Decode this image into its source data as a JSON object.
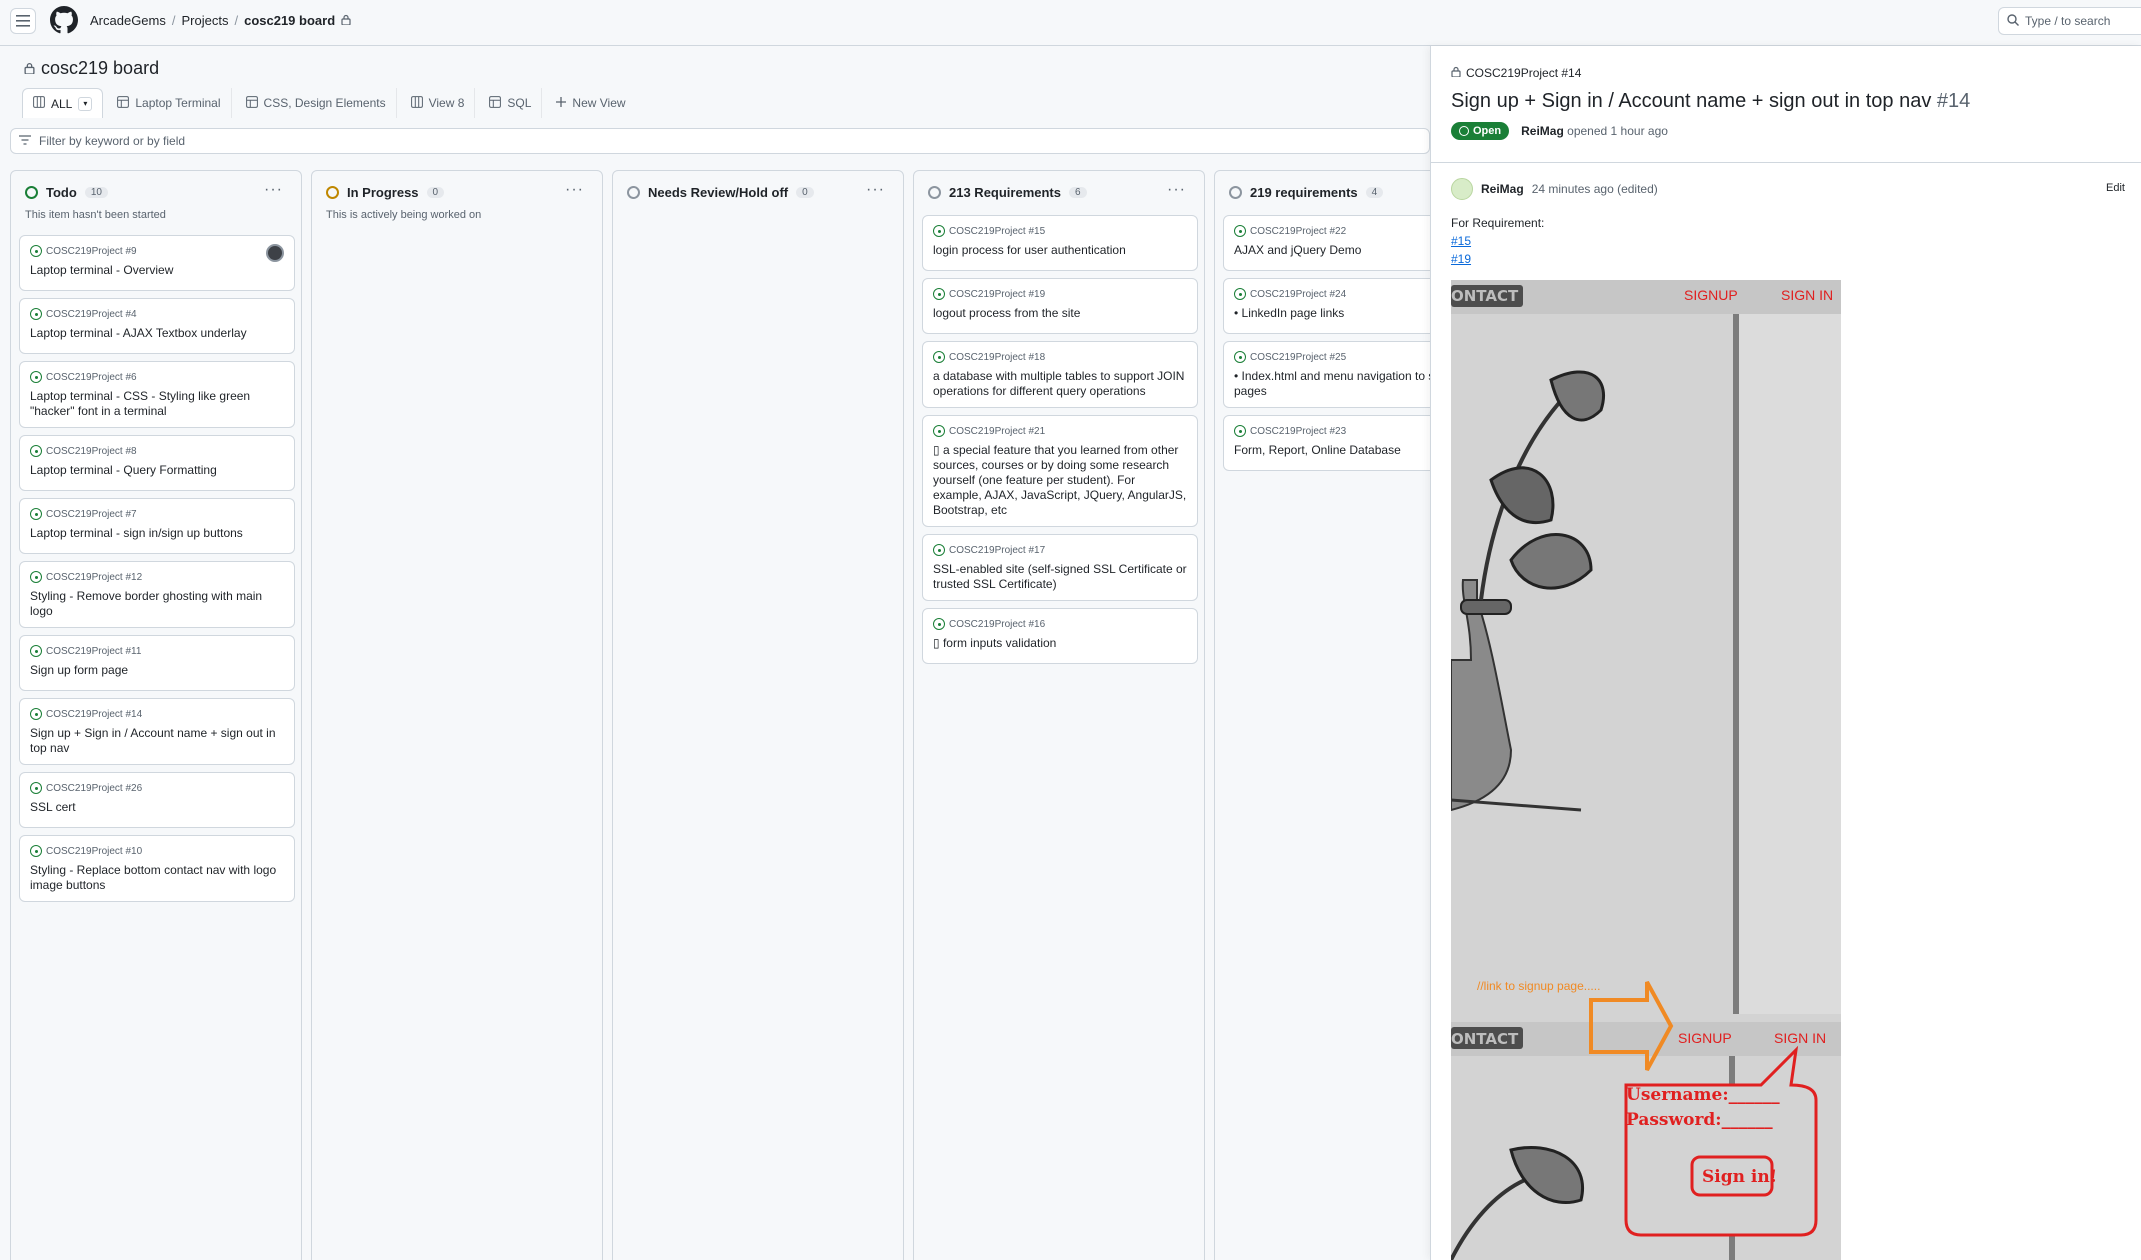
{
  "topbar": {
    "crumbs": [
      "ArcadeGems",
      "Projects",
      "cosc219 board"
    ],
    "separator": "/",
    "search_placeholder": "Type / to search"
  },
  "board": {
    "title": "cosc219 board",
    "tabs": [
      {
        "label": "ALL",
        "icon": "board-icon"
      },
      {
        "label": "Laptop Terminal",
        "icon": "table-icon"
      },
      {
        "label": "CSS, Design Elements",
        "icon": "table-icon"
      },
      {
        "label": "View 8",
        "icon": "board-icon"
      },
      {
        "label": "SQL",
        "icon": "table-icon"
      },
      {
        "label": "New View",
        "icon": "plus-icon"
      }
    ],
    "filter_placeholder": "Filter by keyword or by field"
  },
  "columns": [
    {
      "name": "Todo",
      "count": "10",
      "color": "#1a7f37",
      "description": "This item hasn't been started",
      "cards": [
        {
          "ref": "COSC219Project #9",
          "title": "Laptop terminal - Overview",
          "assignee": true
        },
        {
          "ref": "COSC219Project #4",
          "title": "Laptop terminal - AJAX Textbox underlay"
        },
        {
          "ref": "COSC219Project #6",
          "title": "Laptop terminal - CSS - Styling like green \"hacker\" font in a terminal"
        },
        {
          "ref": "COSC219Project #8",
          "title": "Laptop terminal - Query Formatting"
        },
        {
          "ref": "COSC219Project #7",
          "title": "Laptop terminal - sign in/sign up buttons"
        },
        {
          "ref": "COSC219Project #12",
          "title": "Styling - Remove border ghosting with main logo"
        },
        {
          "ref": "COSC219Project #11",
          "title": "Sign up form page"
        },
        {
          "ref": "COSC219Project #14",
          "title": "Sign up + Sign in / Account name + sign out in top nav"
        },
        {
          "ref": "COSC219Project #26",
          "title": "SSL cert"
        },
        {
          "ref": "COSC219Project #10",
          "title": "Styling - Replace bottom contact nav with logo image buttons"
        }
      ]
    },
    {
      "name": "In Progress",
      "count": "0",
      "color": "#bf8700",
      "description": "This is actively being worked on",
      "cards": []
    },
    {
      "name": "Needs Review/Hold off",
      "count": "0",
      "color": "#8c959f",
      "description": "",
      "cards": []
    },
    {
      "name": "213 Requirements",
      "count": "6",
      "color": "#8c959f",
      "description": "",
      "cards": [
        {
          "ref": "COSC219Project #15",
          "title": "login process for user authentication"
        },
        {
          "ref": "COSC219Project #19",
          "title": "logout process from the site"
        },
        {
          "ref": "COSC219Project #18",
          "title": "a database with multiple tables to support JOIN operations for different query operations"
        },
        {
          "ref": "COSC219Project #21",
          "title": "▯ a special feature that you learned from other sources, courses or by doing some research yourself (one feature per student). For example, AJAX, JavaScript, JQuery, AngularJS, Bootstrap, etc"
        },
        {
          "ref": "COSC219Project #17",
          "title": "SSL-enabled site (self-signed SSL Certificate or trusted SSL Certificate)"
        },
        {
          "ref": "COSC219Project #16",
          "title": "▯ form inputs validation"
        }
      ]
    },
    {
      "name": "219 requirements",
      "count": "4",
      "color": "#8c959f",
      "description": "",
      "cards": [
        {
          "ref": "COSC219Project #22",
          "title": "AJAX and jQuery Demo"
        },
        {
          "ref": "COSC219Project #24",
          "title": "• LinkedIn page links"
        },
        {
          "ref": "COSC219Project #25",
          "title": "• Index.html and menu navigation to s between pages"
        },
        {
          "ref": "COSC219Project #23",
          "title": "Form, Report, Online Database"
        }
      ]
    }
  ],
  "issue_panel": {
    "ref": "COSC219Project #14",
    "title": "Sign up + Sign in / Account name + sign out in top nav",
    "number": "#14",
    "status": "Open",
    "author": "ReiMag",
    "opened": "opened 1 hour ago",
    "comment_author": "ReiMag",
    "comment_time": "24 minutes ago (edited)",
    "edit_label": "Edit",
    "body_intro": "For Requirement:",
    "links": [
      "#15",
      "#19"
    ],
    "mockup": {
      "contact": "ONTACT",
      "signup": "SIGNUP",
      "signin": "SIGN IN",
      "note": "//link to signup page.....",
      "username": "Username:______",
      "password": "Password:______",
      "button": "Sign in!"
    }
  }
}
